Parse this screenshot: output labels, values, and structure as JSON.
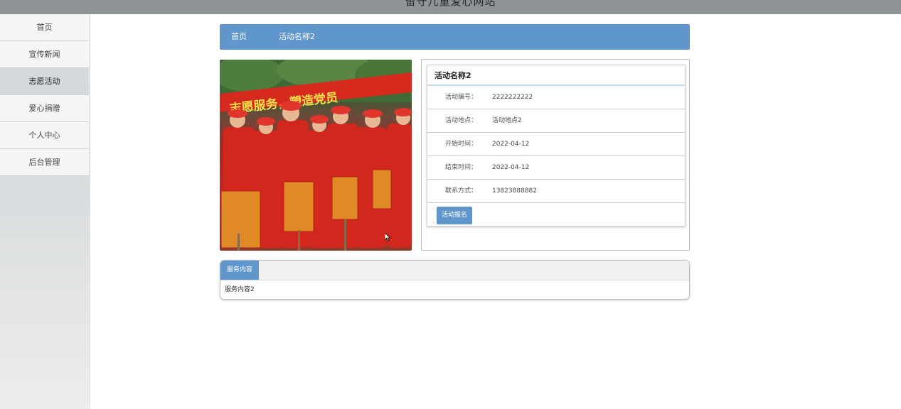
{
  "header": {
    "site_title": "留守儿童爱心网站"
  },
  "sidebar": {
    "items": [
      {
        "label": "首页"
      },
      {
        "label": "宣传新闻"
      },
      {
        "label": "志愿活动",
        "active": true
      },
      {
        "label": "爱心捐赠"
      },
      {
        "label": "个人中心"
      },
      {
        "label": "后台管理"
      }
    ]
  },
  "breadcrumb": {
    "home": "首页",
    "current": "活动名称2"
  },
  "activity": {
    "name": "活动名称2",
    "fields": [
      {
        "label": "活动编号：",
        "value": "2222222222"
      },
      {
        "label": "活动地点：",
        "value": "活动地点2"
      },
      {
        "label": "开始时间：",
        "value": "2022-04-12"
      },
      {
        "label": "结束时间：",
        "value": "2022-04-12"
      },
      {
        "label": "联系方式：",
        "value": "13823888882"
      }
    ],
    "signup_label": "活动报名",
    "photo_icon": "volunteer-group-photo",
    "banner_text": "志愿服务，塑造党员"
  },
  "tabs": {
    "items": [
      {
        "label": "服务内容"
      }
    ],
    "content": "服务内容2"
  },
  "colors": {
    "accent": "#5f96cc",
    "topbar": "#8f9497"
  }
}
